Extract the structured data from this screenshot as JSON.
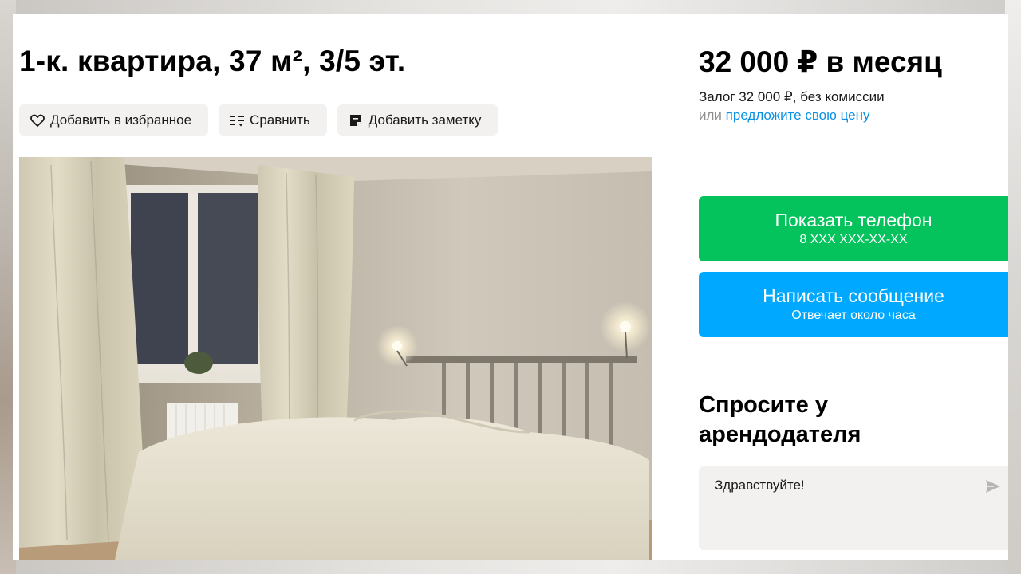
{
  "listing": {
    "title": "1-к. квартира, 37 м², 3/5 эт."
  },
  "actions": {
    "favorite_label": "Добавить в избранное",
    "favorite_icon": "heart-icon",
    "compare_label": "Сравнить",
    "compare_icon": "compare-icon",
    "note_label": "Добавить заметку",
    "note_icon": "note-icon"
  },
  "pricing": {
    "price": "32 000 ₽ в месяц",
    "deposit": "Залог 32 000 ₽, без комиссии",
    "offer_prefix": "или",
    "offer_link": "предложите свою цену"
  },
  "contact": {
    "phone_button_label": "Показать телефон",
    "phone_button_sub": "8 XXX XXX-XX-XX",
    "message_button_label": "Написать сообщение",
    "message_button_sub": "Отвечает около часа"
  },
  "ask": {
    "title": "Спросите у арендодателя",
    "message_value": "Здравствуйте!",
    "send_icon": "send-icon"
  },
  "colors": {
    "green": "#04c35c",
    "blue": "#00a8ff",
    "link": "#0a91e4",
    "button_bg": "#f2f1f0"
  }
}
